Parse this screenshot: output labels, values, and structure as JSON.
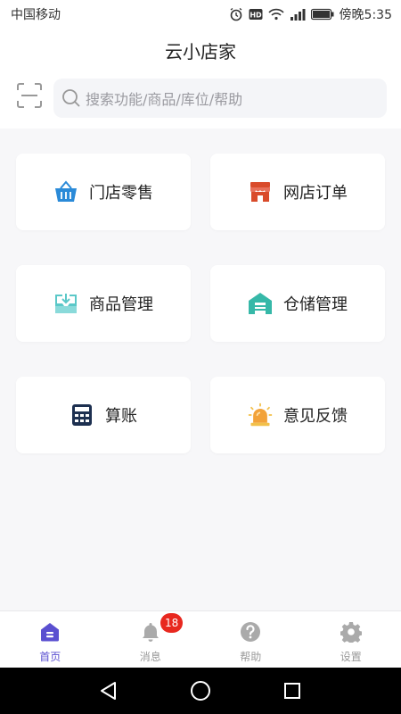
{
  "status_bar": {
    "carrier": "中国移动",
    "time": "傍晚5:35",
    "icons": [
      "alarm-icon",
      "hd-icon",
      "wifi-icon",
      "signal-icon",
      "battery-icon"
    ]
  },
  "header": {
    "title": "云小店家"
  },
  "search": {
    "placeholder": "搜索功能/商品/库位/帮助"
  },
  "grid": [
    {
      "label": "门店零售",
      "icon": "basket-icon",
      "color": "#2a8ad8"
    },
    {
      "label": "网店订单",
      "icon": "storefront-icon",
      "color": "#d94b2b"
    },
    {
      "label": "商品管理",
      "icon": "inbox-icon",
      "color": "#5bc8c8"
    },
    {
      "label": "仓储管理",
      "icon": "warehouse-icon",
      "color": "#36b8a8"
    },
    {
      "label": "算账",
      "icon": "calculator-icon",
      "color": "#1d3050"
    },
    {
      "label": "意见反馈",
      "icon": "siren-icon",
      "color": "#f2a23a"
    }
  ],
  "tabs": [
    {
      "label": "首页",
      "icon": "home-icon",
      "active": true
    },
    {
      "label": "消息",
      "icon": "bell-icon",
      "badge": "18"
    },
    {
      "label": "帮助",
      "icon": "help-icon"
    },
    {
      "label": "设置",
      "icon": "gear-icon"
    }
  ],
  "colors": {
    "accent": "#5a4fd0",
    "badge": "#e8281f",
    "inactive": "#999999"
  }
}
